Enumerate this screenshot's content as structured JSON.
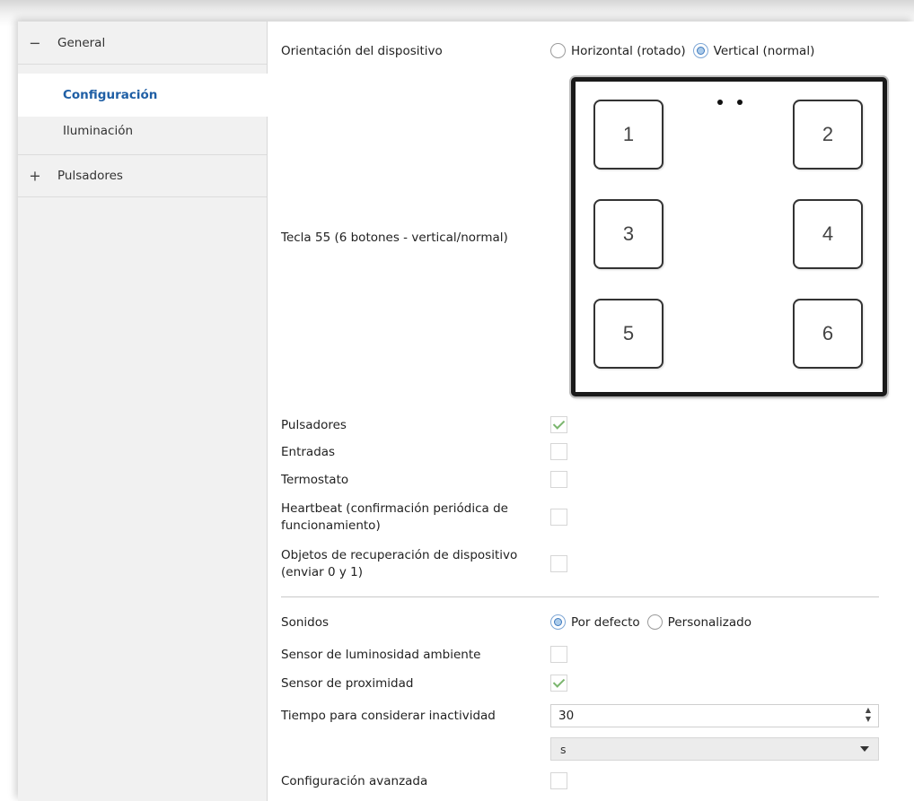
{
  "sidebar": {
    "groups": [
      {
        "sign": "−",
        "label": "General"
      },
      {
        "sign": "+",
        "label": "Pulsadores"
      }
    ],
    "items": [
      {
        "label": "Configuración"
      },
      {
        "label": "Iluminación"
      }
    ]
  },
  "main": {
    "orientation": {
      "label": "Orientación del dispositivo",
      "options": [
        "Horizontal (rotado)",
        "Vertical (normal)"
      ],
      "selected": "Vertical (normal)"
    },
    "device": {
      "label": "Tecla 55 (6 botones - vertical/normal)",
      "buttons": [
        "1",
        "2",
        "3",
        "4",
        "5",
        "6"
      ]
    },
    "checks": [
      {
        "label": "Pulsadores",
        "checked": true
      },
      {
        "label": "Entradas",
        "checked": false
      },
      {
        "label": "Termostato",
        "checked": false
      },
      {
        "label": "Heartbeat (confirmación periódica de funcionamiento)",
        "checked": false
      },
      {
        "label": "Objetos de recuperación de dispositivo (enviar 0 y 1)",
        "checked": false
      }
    ],
    "sounds": {
      "label": "Sonidos",
      "options": [
        "Por defecto",
        "Personalizado"
      ],
      "selected": "Por defecto"
    },
    "ambient_sensor": {
      "label": "Sensor de luminosidad ambiente",
      "checked": false
    },
    "proximity_sensor": {
      "label": "Sensor de proximidad",
      "checked": true
    },
    "inactivity": {
      "label": "Tiempo para considerar inactividad",
      "value": "30",
      "unit": "s"
    },
    "advanced": {
      "label": "Configuración avanzada",
      "checked": false
    }
  }
}
